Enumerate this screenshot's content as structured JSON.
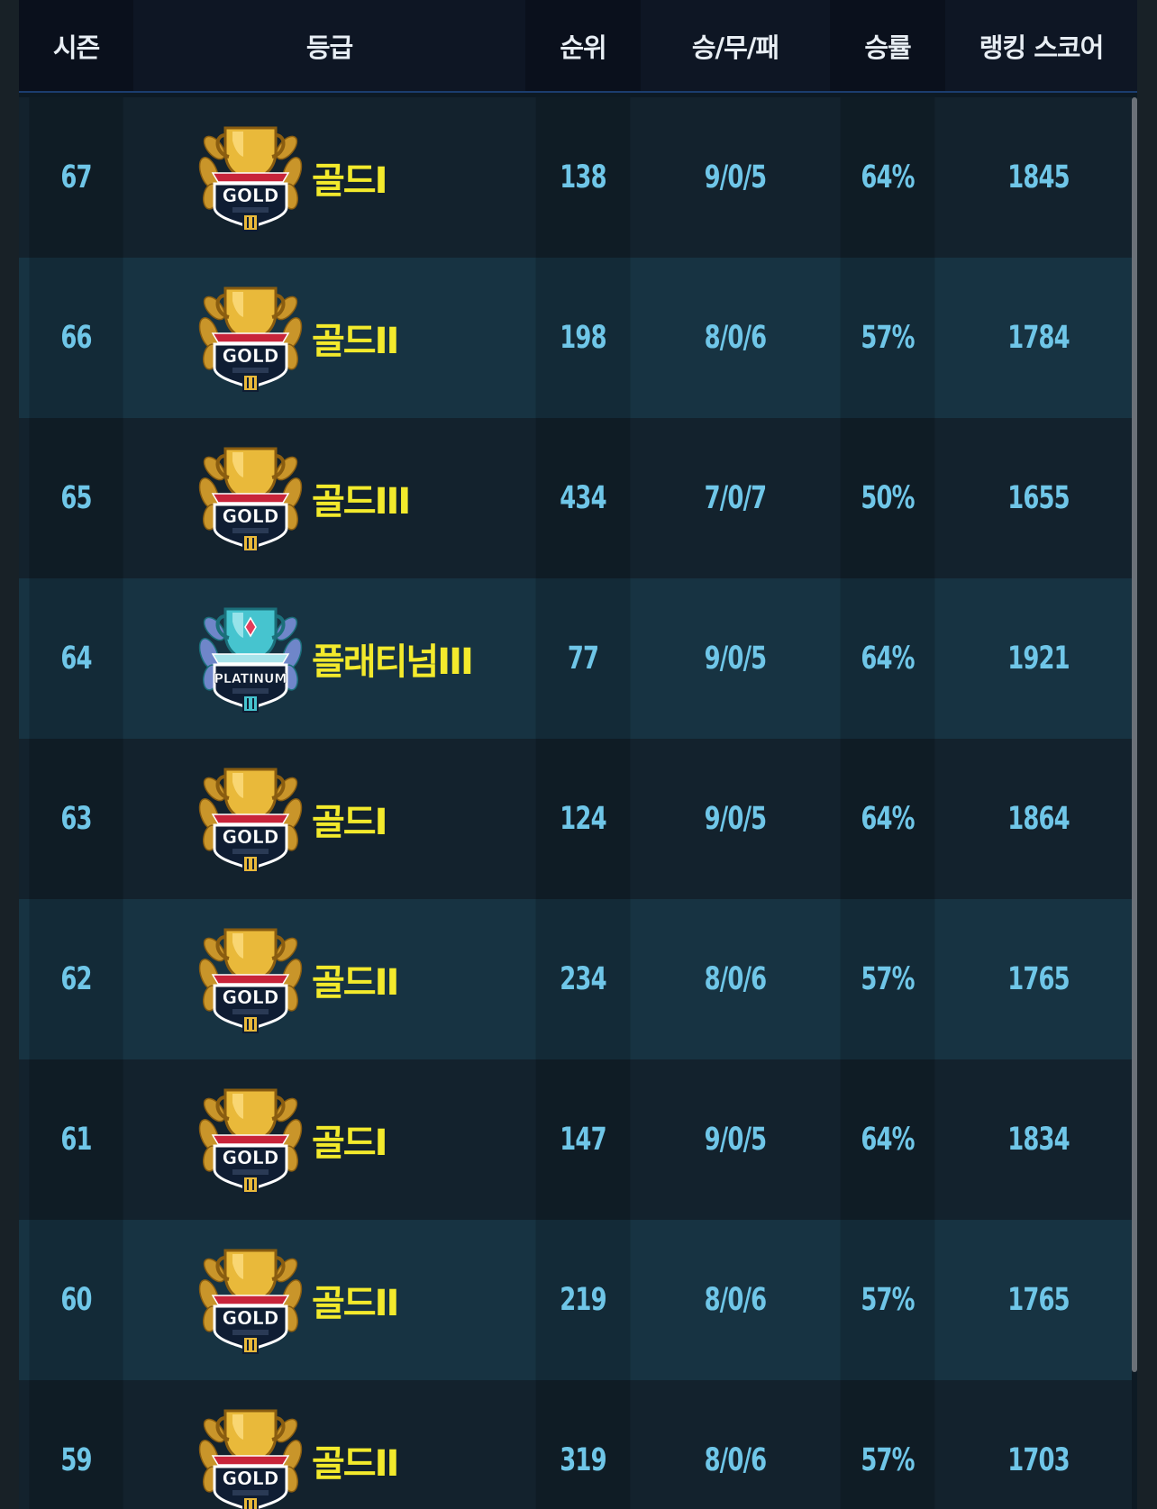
{
  "header": {
    "season": "시즌",
    "grade": "등급",
    "rank": "순위",
    "wdl": "승/무/패",
    "win_rate": "승률",
    "ranking_score": "랭킹 스코어"
  },
  "rows": [
    {
      "season": "67",
      "grade": "골드I",
      "badge": "gold-trophy-icon",
      "rank": "138",
      "wdl": "9/0/5",
      "win_rate": "64%",
      "score": "1845"
    },
    {
      "season": "66",
      "grade": "골드II",
      "badge": "gold-trophy-icon",
      "rank": "198",
      "wdl": "8/0/6",
      "win_rate": "57%",
      "score": "1784"
    },
    {
      "season": "65",
      "grade": "골드III",
      "badge": "gold-trophy-icon",
      "rank": "434",
      "wdl": "7/0/7",
      "win_rate": "50%",
      "score": "1655"
    },
    {
      "season": "64",
      "grade": "플래티넘III",
      "badge": "platinum-trophy-icon",
      "rank": "77",
      "wdl": "9/0/5",
      "win_rate": "64%",
      "score": "1921"
    },
    {
      "season": "63",
      "grade": "골드I",
      "badge": "gold-trophy-icon",
      "rank": "124",
      "wdl": "9/0/5",
      "win_rate": "64%",
      "score": "1864"
    },
    {
      "season": "62",
      "grade": "골드II",
      "badge": "gold-trophy-icon",
      "rank": "234",
      "wdl": "8/0/6",
      "win_rate": "57%",
      "score": "1765"
    },
    {
      "season": "61",
      "grade": "골드I",
      "badge": "gold-trophy-icon",
      "rank": "147",
      "wdl": "9/0/5",
      "win_rate": "64%",
      "score": "1834"
    },
    {
      "season": "60",
      "grade": "골드II",
      "badge": "gold-trophy-icon",
      "rank": "219",
      "wdl": "8/0/6",
      "win_rate": "57%",
      "score": "1765"
    },
    {
      "season": "59",
      "grade": "골드II",
      "badge": "gold-trophy-icon",
      "rank": "319",
      "wdl": "8/0/6",
      "win_rate": "57%",
      "score": "1703"
    }
  ],
  "badges": {
    "gold": {
      "label": "GOLD",
      "primary": "#e9b93a",
      "dark": "#8a5d10",
      "light": "#ffe38a"
    },
    "platinum": {
      "label": "PLATINUM",
      "primary": "#46c4cf",
      "dark": "#1b6f7a",
      "light": "#b9f1f5"
    }
  },
  "colors": {
    "grade_text": "#f3ea2c",
    "value_text": "#6fc6e8",
    "header_text": "#e8eef4",
    "row_odd": "#13222d",
    "row_even": "#173342"
  }
}
